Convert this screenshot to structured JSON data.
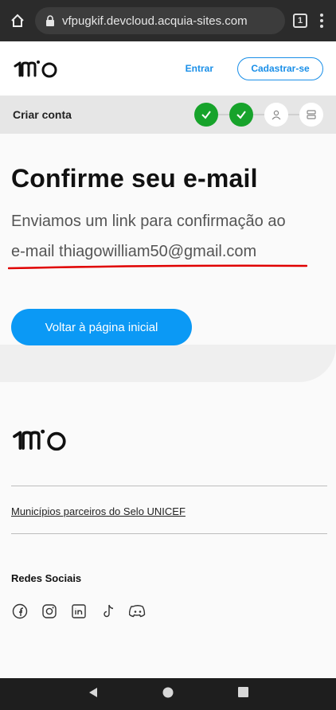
{
  "browser": {
    "url": "vfpugkif.devcloud.acquia-sites.com",
    "tab_count": "1"
  },
  "header": {
    "brand": "1MiO",
    "login_label": "Entrar",
    "signup_label": "Cadastrar-se"
  },
  "stepbar": {
    "title": "Criar conta",
    "steps": [
      "done",
      "done",
      "user",
      "server"
    ]
  },
  "main": {
    "heading": "Confirme seu e-mail",
    "lead": "Enviamos um link para confirmação ao",
    "email_line": "e-mail thiagowilliam50@gmail.com",
    "back_button": "Voltar à página inicial"
  },
  "footer": {
    "partner_link": "Municípios parceiros do Selo UNICEF",
    "social_title": "Redes Sociais",
    "socials": [
      "facebook-icon",
      "instagram-icon",
      "linkedin-icon",
      "tiktok-icon",
      "discord-icon"
    ]
  },
  "colors": {
    "accent": "#0b99f5",
    "step_done": "#17a32b",
    "annotation": "#e00000"
  }
}
